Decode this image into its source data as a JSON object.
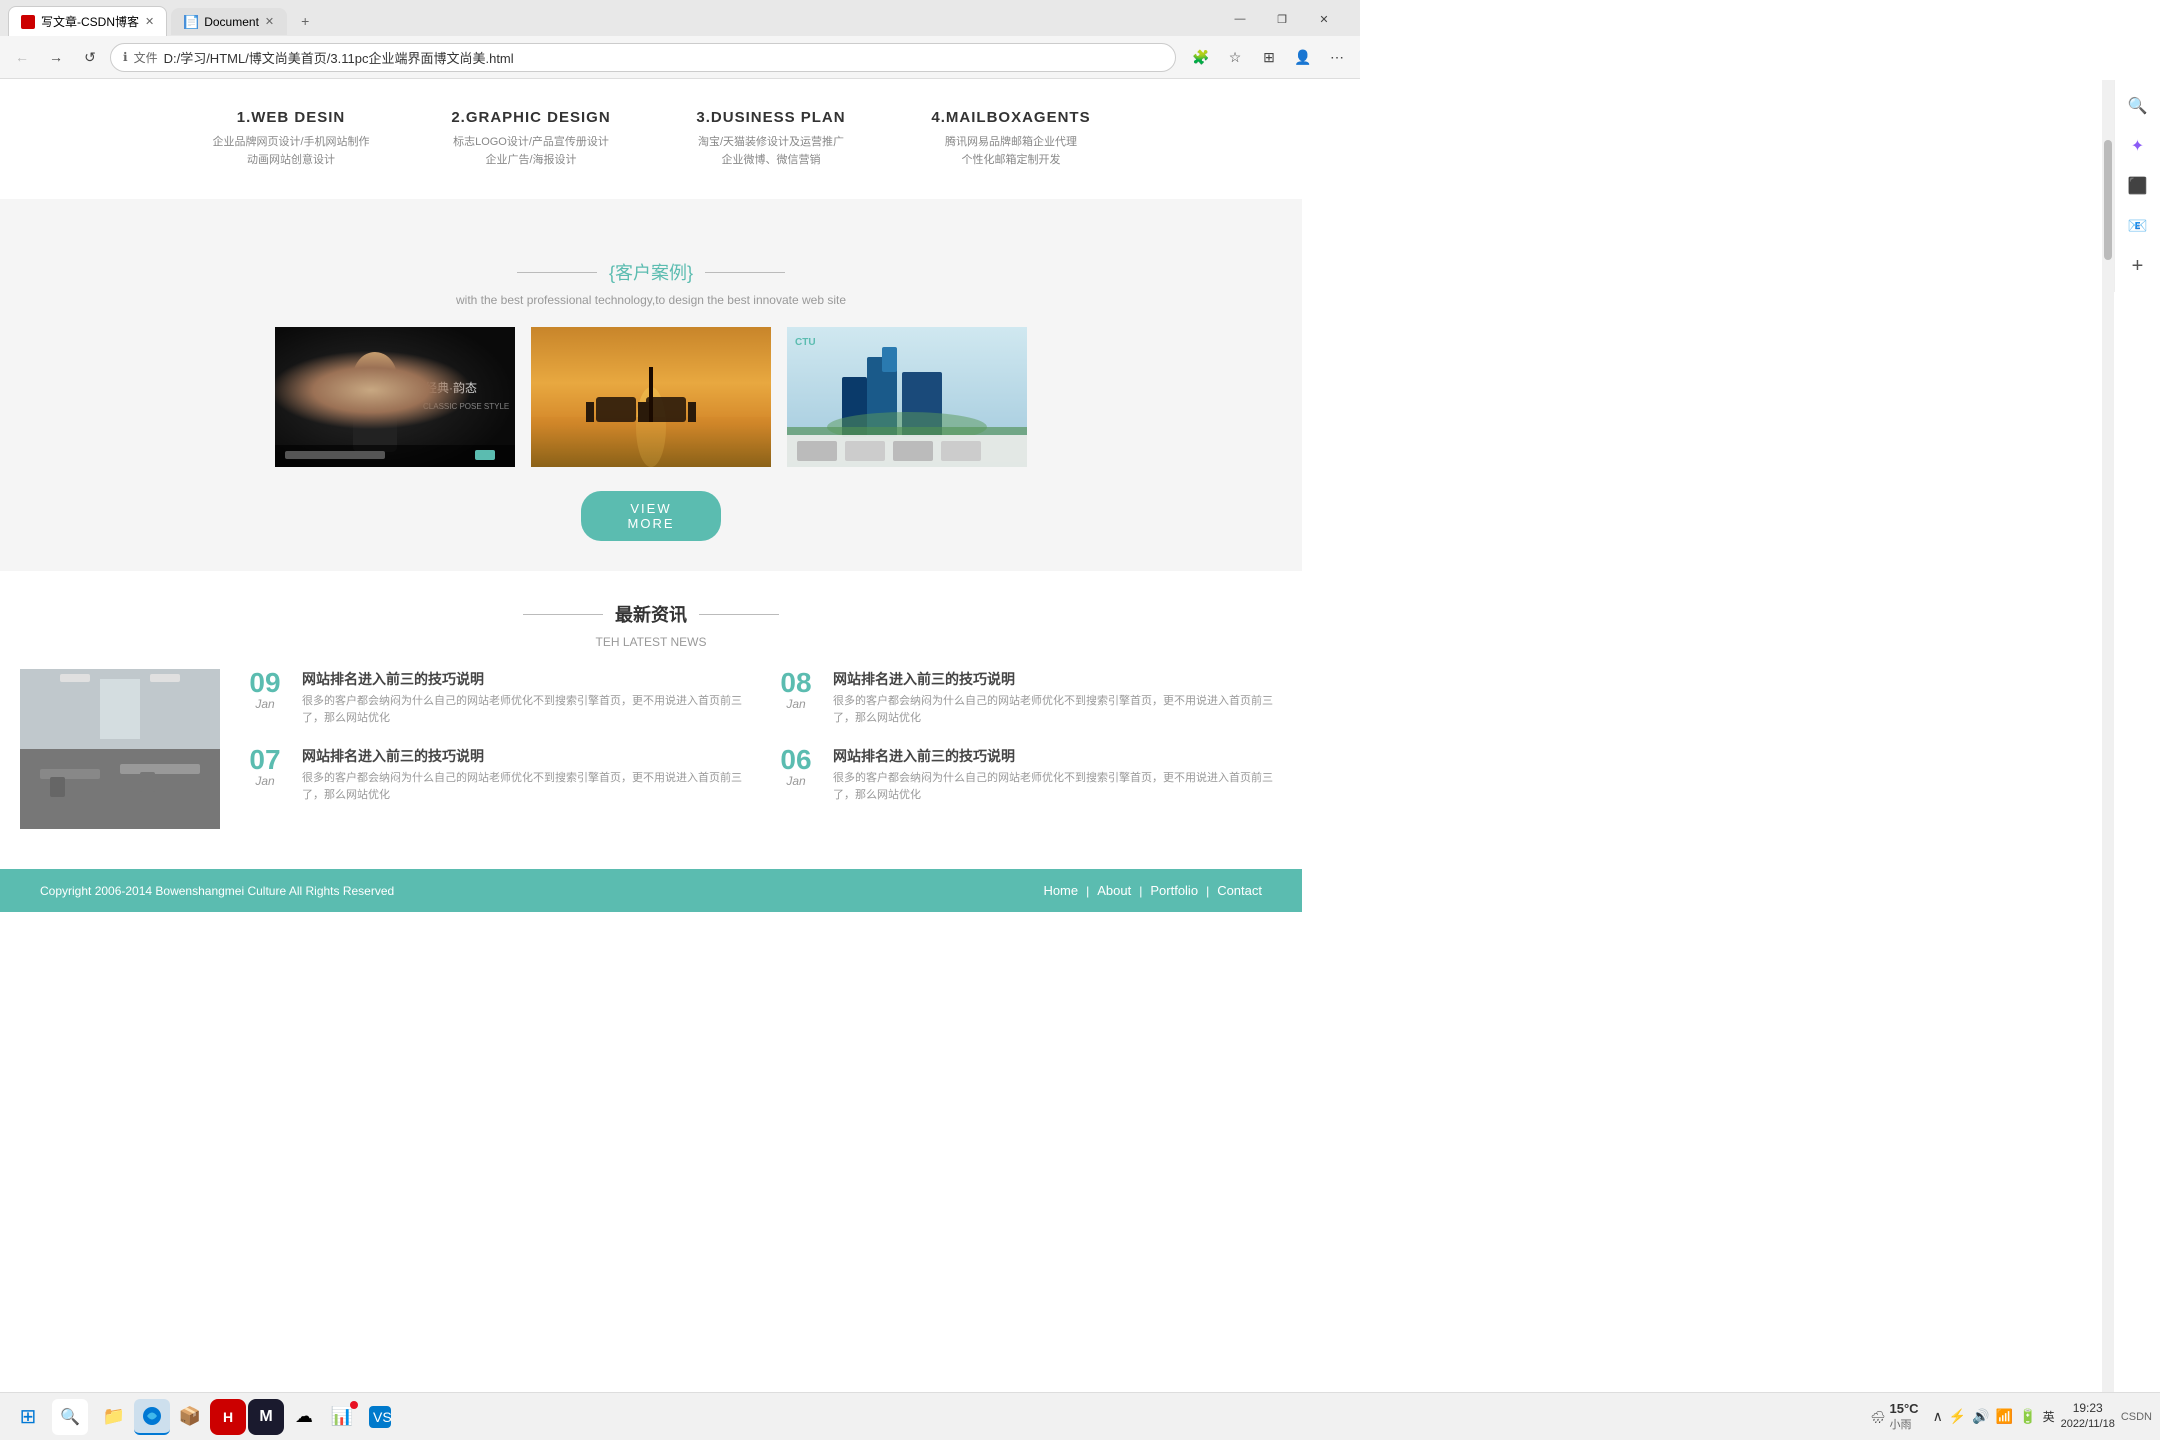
{
  "browser": {
    "tabs": [
      {
        "id": "tab1",
        "title": "写文章-CSDN博客",
        "active": true,
        "icon": "csdn"
      },
      {
        "id": "tab2",
        "title": "Document",
        "active": false,
        "icon": "doc"
      }
    ],
    "address": "D:/学习/HTML/博文尚美首页/3.11pc企业端界面博文尚美.html",
    "address_prefix": "文件",
    "new_tab_label": "+",
    "window_controls": [
      "—",
      "❐",
      "✕"
    ]
  },
  "toolbar": {
    "icons": [
      "🔍",
      "⭐",
      "✦",
      "📋",
      "⊕"
    ]
  },
  "right_sidebar": {
    "icons": [
      {
        "name": "search",
        "glyph": "🔍"
      },
      {
        "name": "star",
        "glyph": "✦"
      },
      {
        "name": "office",
        "glyph": "⬛"
      },
      {
        "name": "mail",
        "glyph": "📧"
      },
      {
        "name": "add",
        "glyph": "+"
      }
    ]
  },
  "services": {
    "items": [
      {
        "id": "web-design",
        "title": "1.WEB DESIN",
        "lines": [
          "企业品牌网页设计/手机网站制作",
          "动画网站创意设计"
        ]
      },
      {
        "id": "graphic-design",
        "title": "2.GRAPHIC DESIGN",
        "lines": [
          "标志LOGO设计/产品宣传册设计",
          "企业广告/海报设计"
        ]
      },
      {
        "id": "business-plan",
        "title": "3.DUSINESS PLAN",
        "lines": [
          "淘宝/天猫装修设计及运营推广",
          "企业微博、微信营销"
        ]
      },
      {
        "id": "mailbox",
        "title": "4.MAILBOXAGENTS",
        "lines": [
          "腾讯网易品牌邮箱企业代理",
          "个性化邮箱定制开发"
        ]
      }
    ]
  },
  "clients_section": {
    "header_decoration": "——",
    "title_cn": "{客户案例}",
    "title_en": "with the best professional technology,to design the best innovate web site",
    "portfolio": [
      {
        "id": "p1",
        "alt": "时尚男士网站"
      },
      {
        "id": "p2",
        "alt": "风景网站"
      },
      {
        "id": "p3",
        "alt": "企业蓝色网站"
      }
    ],
    "view_more_label": "VIEW MORE"
  },
  "news_section": {
    "title_cn": "最新资讯",
    "title_en": "TEH LATEST NEWS",
    "image_alt": "办公室图片",
    "items": [
      {
        "day": "09",
        "month": "Jan",
        "title": "网站排名进入前三的技巧说明",
        "excerpt": "很多的客户都会纳闷为什么自己的网站老师优化不到搜索引擎首页，更不用说进入首页前三了，那么网站优化"
      },
      {
        "day": "08",
        "month": "Jan",
        "title": "网站排名进入前三的技巧说明",
        "excerpt": "很多的客户都会纳闷为什么自己的网站老师优化不到搜索引擎首页，更不用说进入首页前三了，那么网站优化"
      },
      {
        "day": "07",
        "month": "Jan",
        "title": "网站排名进入前三的技巧说明",
        "excerpt": "很多的客户都会纳闷为什么自己的网站老师优化不到搜索引擎首页，更不用说进入首页前三了，那么网站优化"
      },
      {
        "day": "06",
        "month": "Jan",
        "title": "网站排名进入前三的技巧说明",
        "excerpt": "很多的客户都会纳闷为什么自己的网站老师优化不到搜索引擎首页，更不用说进入首页前三了，那么网站优化"
      }
    ]
  },
  "footer": {
    "copyright": "Copyright 2006-2014 Bowenshangmei Culture All Rights Reserved",
    "nav": [
      "Home",
      "About",
      "Portfolio",
      "Contact"
    ],
    "separator": "|"
  },
  "taskbar": {
    "weather_temp": "15°C",
    "weather_desc": "小雨",
    "time": "19:23",
    "date": "2022/11/18",
    "tray_label": "CSDN",
    "apps": [
      {
        "name": "windows-start",
        "glyph": "⊞"
      },
      {
        "name": "search",
        "glyph": "🔍"
      },
      {
        "name": "file-explorer",
        "glyph": "📁"
      },
      {
        "name": "edge",
        "glyph": "🌐"
      },
      {
        "name": "app3",
        "glyph": "📦"
      },
      {
        "name": "app4",
        "glyph": "📱"
      },
      {
        "name": "app5",
        "glyph": "M"
      },
      {
        "name": "app6",
        "glyph": "☁"
      },
      {
        "name": "app7",
        "glyph": "📊"
      },
      {
        "name": "vscode",
        "glyph": "💙"
      }
    ]
  }
}
